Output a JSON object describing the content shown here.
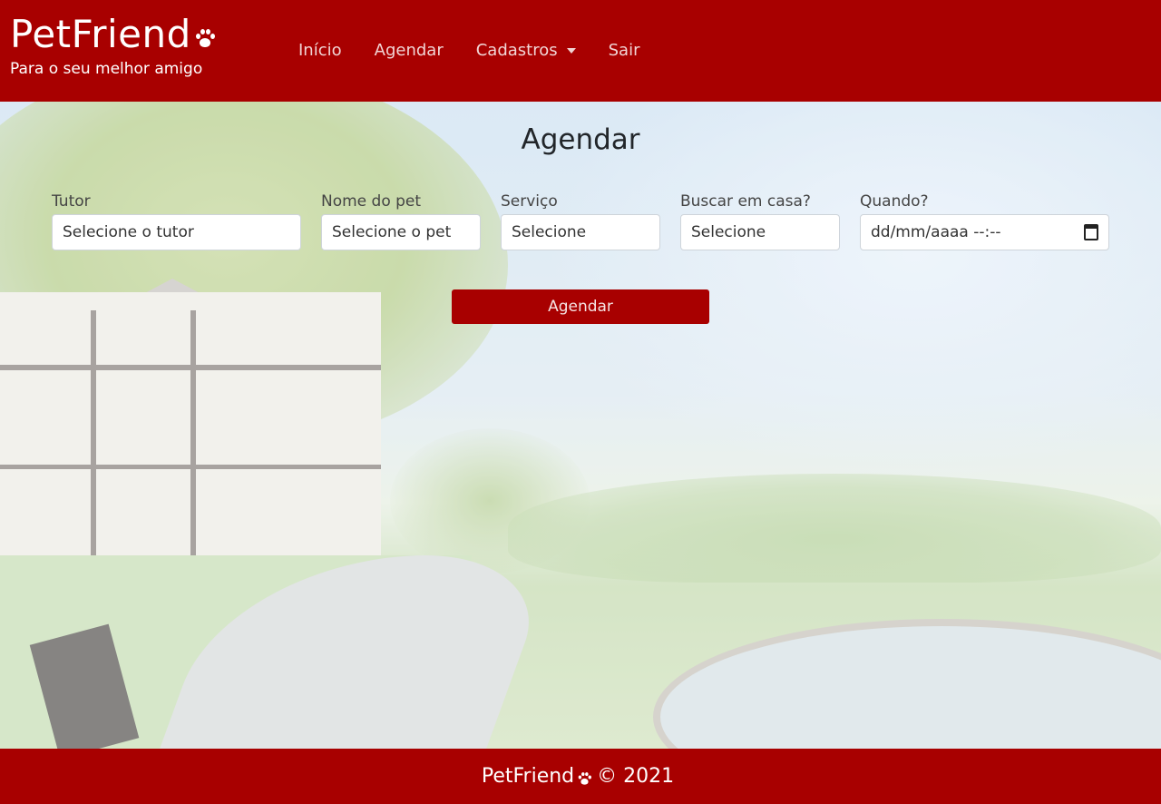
{
  "brand": {
    "title": "PetFriend",
    "subtitle": "Para o seu melhor amigo"
  },
  "nav": {
    "items": [
      {
        "label": "Início"
      },
      {
        "label": "Agendar"
      },
      {
        "label": "Cadastros"
      },
      {
        "label": "Sair"
      }
    ]
  },
  "page": {
    "title": "Agendar"
  },
  "form": {
    "tutor": {
      "label": "Tutor",
      "placeholder": "Selecione o tutor"
    },
    "pet": {
      "label": "Nome do pet",
      "placeholder": "Selecione o pet"
    },
    "servico": {
      "label": "Serviço",
      "placeholder": "Selecione"
    },
    "buscar": {
      "label": "Buscar em casa?",
      "placeholder": "Selecione"
    },
    "quando": {
      "label": "Quando?",
      "value": "dd/mm/aaaa --:--"
    },
    "submit_label": "Agendar"
  },
  "footer": {
    "brand": "PetFriend",
    "copyright": "© 2021"
  },
  "colors": {
    "primary": "#a80000"
  },
  "icons": {
    "brand": "paw-icon",
    "dropdown": "caret-down-icon",
    "date": "calendar-icon"
  }
}
